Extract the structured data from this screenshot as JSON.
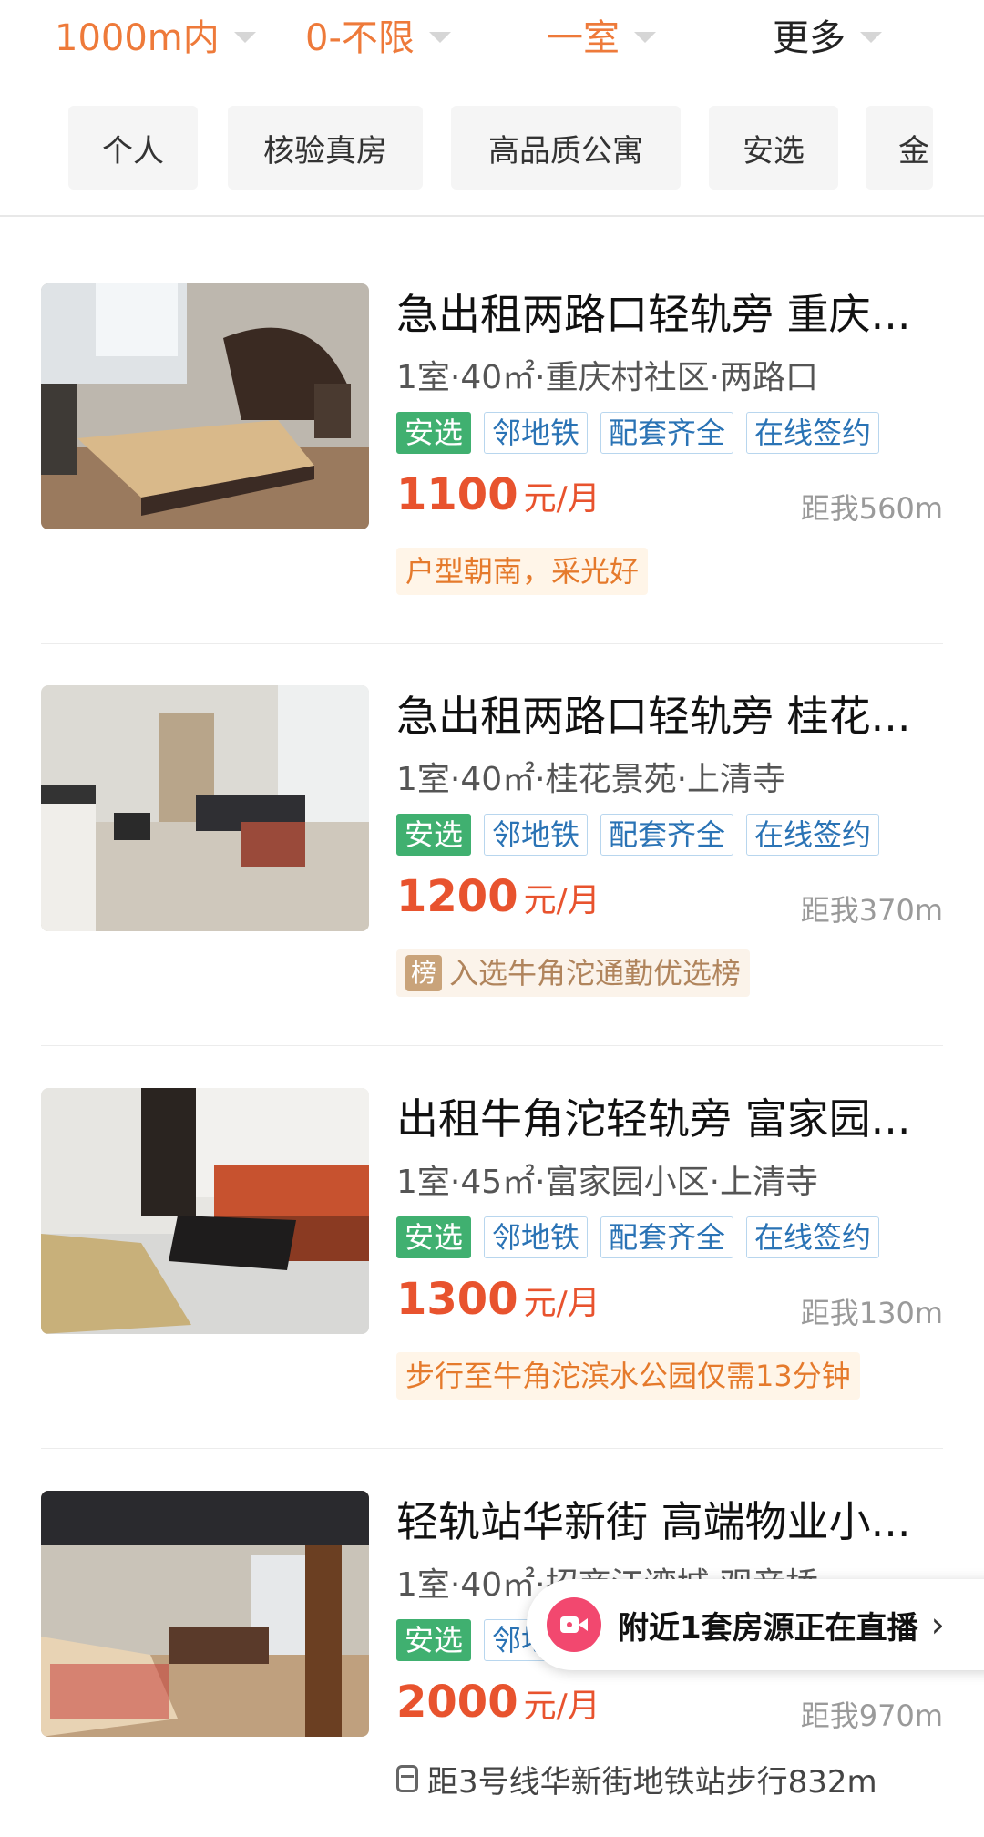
{
  "filters": [
    {
      "label": "1000m内",
      "active": true
    },
    {
      "label": "0-不限",
      "active": true
    },
    {
      "label": "一室",
      "active": true
    },
    {
      "label": "更多",
      "active": false
    }
  ],
  "chips": [
    "个人",
    "核验真房",
    "高品质公寓",
    "安选",
    "金"
  ],
  "listings": [
    {
      "title": "急出租两路口轻轨旁 重庆...",
      "meta": "1室·40㎡·重庆村社区·两路口",
      "tags": [
        "安选",
        "邻地铁",
        "配套齐全",
        "在线签约"
      ],
      "price": "1100",
      "unit": "元/月",
      "distance": "距我560m",
      "highlight": "户型朝南，采光好"
    },
    {
      "title": "急出租两路口轻轨旁 桂花...",
      "meta": "1室·40㎡·桂花景苑·上清寺",
      "tags": [
        "安选",
        "邻地铁",
        "配套齐全",
        "在线签约"
      ],
      "price": "1200",
      "unit": "元/月",
      "distance": "距我370m",
      "rank_badge": "榜",
      "highlight": "入选牛角沱通勤优选榜"
    },
    {
      "title": "出租牛角沱轻轨旁 富家园...",
      "meta": "1室·45㎡·富家园小区·上清寺",
      "tags": [
        "安选",
        "邻地铁",
        "配套齐全",
        "在线签约"
      ],
      "price": "1300",
      "unit": "元/月",
      "distance": "距我130m",
      "highlight": "步行至牛角沱滨水公园仅需13分钟"
    },
    {
      "title": "轻轨站华新街 高端物业小...",
      "meta": "1室·40㎡·招商江湾城·观音桥",
      "tags": [
        "安选",
        "邻地铁"
      ],
      "price": "2000",
      "unit": "元/月",
      "distance": "距我970m",
      "metro_note": "距3号线华新街地铁站步行832m"
    }
  ],
  "live_banner": {
    "text": "附近1套房源正在直播",
    "arrow": "›",
    "icon": "live-video-icon"
  }
}
